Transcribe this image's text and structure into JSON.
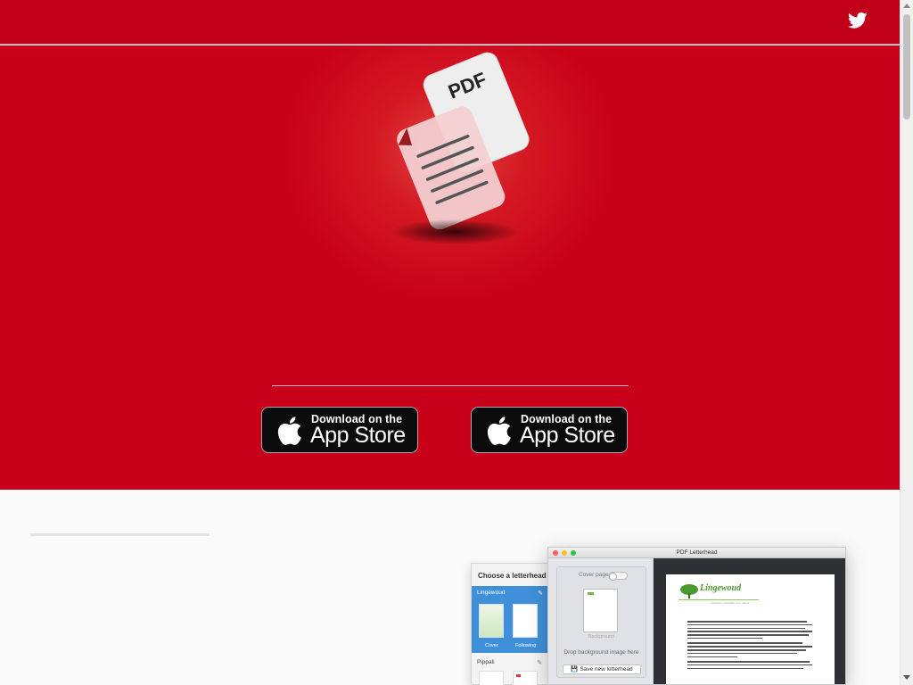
{
  "header": {
    "twitter_icon": "twitter-bird-icon"
  },
  "hero": {
    "logo_text": "PDF",
    "badges": [
      {
        "line1": "Download on the",
        "line2": "App Store"
      },
      {
        "line1": "Download on the",
        "line2": "App Store"
      }
    ]
  },
  "screenshot": {
    "sidebar": {
      "title": "Choose a letterhead",
      "selected_name": "Lingewoud",
      "thumb_cover": "Cover",
      "thumb_following": "Following",
      "second_name": "Pippali"
    },
    "window": {
      "title": "PDF Letterhead",
      "cover_page_label": "Cover page",
      "background_caption": "Background",
      "drop_text": "Drop background image here",
      "save_button": "Save new letterhead"
    },
    "letterhead": {
      "company_name": "Lingewoud",
      "tagline": "duurzaam verbinden voor natuur"
    }
  },
  "colors": {
    "brand_red": "#c8001a",
    "header_red": "#c20019",
    "app_blue": "#3f90d9"
  }
}
